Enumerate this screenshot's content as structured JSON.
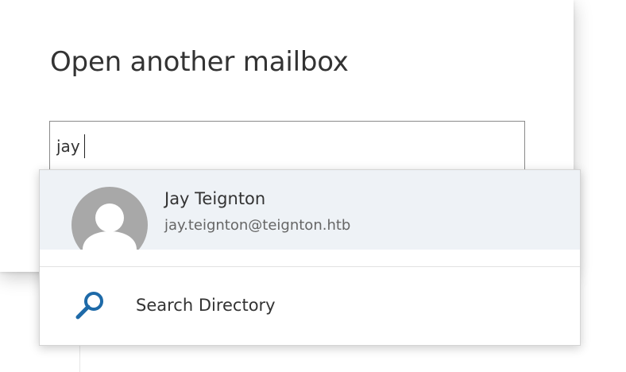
{
  "dialog": {
    "title": "Open another mailbox"
  },
  "mailbox_input": {
    "value": "jay"
  },
  "suggestions": {
    "person": {
      "name": "Jay Teignton",
      "email": "jay.teignton@teignton.htb",
      "icon": "avatar-placeholder-icon"
    },
    "search_directory": {
      "label": "Search Directory",
      "icon": "search-icon"
    }
  },
  "colors": {
    "selected_row_bg": "#eef2f6",
    "accent_icon": "#1e6aa8",
    "avatar_gray": "#a8a8a8"
  }
}
